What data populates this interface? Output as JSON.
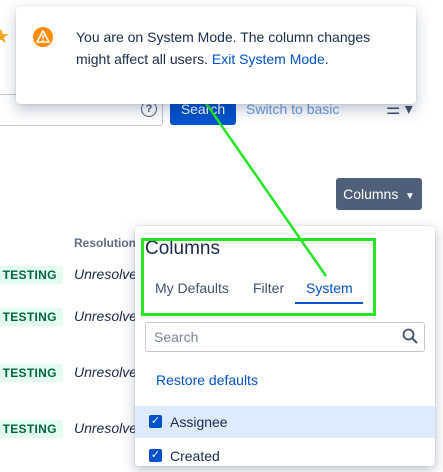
{
  "banner": {
    "message": "You are on System Mode. The column changes might affect all users.",
    "link": "Exit System Mode",
    "suffix": "."
  },
  "toolbar": {
    "search_button": "Search",
    "switch_link": "Switch to basic",
    "help": "?"
  },
  "columns_button": "Columns",
  "table": {
    "header_resolution": "Resolution",
    "rows": [
      {
        "status": "R TESTING",
        "resolution": "Unresolved"
      },
      {
        "status": "R TESTING",
        "resolution": "Unresolve"
      },
      {
        "status": "R TESTING",
        "resolution": "Unresolve"
      },
      {
        "status": "R TESTING",
        "resolution": "Unresolve"
      }
    ]
  },
  "columns_panel": {
    "title": "Columns",
    "tabs": [
      "My Defaults",
      "Filter",
      "System"
    ],
    "active_tab": "System",
    "search_placeholder": "Search",
    "restore": "Restore defaults",
    "options": [
      {
        "label": "Assignee",
        "checked": true
      },
      {
        "label": "Created",
        "checked": true
      }
    ]
  },
  "colors": {
    "primary": "#0052cc",
    "annotation": "#22e622",
    "warning": "#ff8b00"
  }
}
